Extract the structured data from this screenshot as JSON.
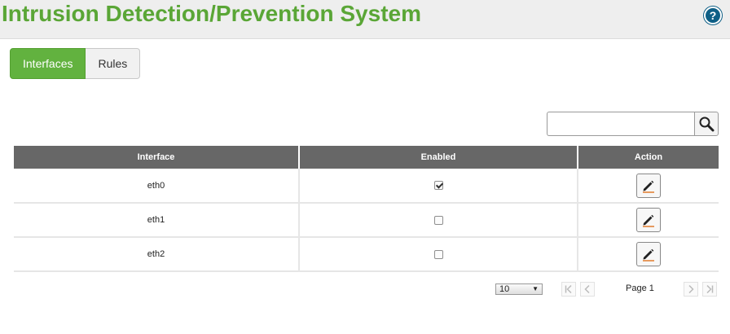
{
  "header": {
    "title": "Intrusion Detection/Prevention System",
    "help_label": "?"
  },
  "tabs": [
    {
      "label": "Interfaces",
      "active": true
    },
    {
      "label": "Rules",
      "active": false
    }
  ],
  "search": {
    "value": "",
    "placeholder": ""
  },
  "table": {
    "columns": [
      "Interface",
      "Enabled",
      "Action"
    ],
    "rows": [
      {
        "interface": "eth0",
        "enabled": true
      },
      {
        "interface": "eth1",
        "enabled": false
      },
      {
        "interface": "eth2",
        "enabled": false
      }
    ]
  },
  "pager": {
    "page_size": "10",
    "page_label": "Page 1"
  },
  "colors": {
    "title_green": "#5aa636",
    "tab_active": "#62b23f",
    "header_gray": "#676767",
    "help_blue": "#0e5f86"
  },
  "icons": {
    "help": "question-icon",
    "search": "magnifier-icon",
    "edit": "pencil-icon",
    "first": "first-page-icon",
    "prev": "previous-page-icon",
    "next": "next-page-icon",
    "last": "last-page-icon"
  }
}
